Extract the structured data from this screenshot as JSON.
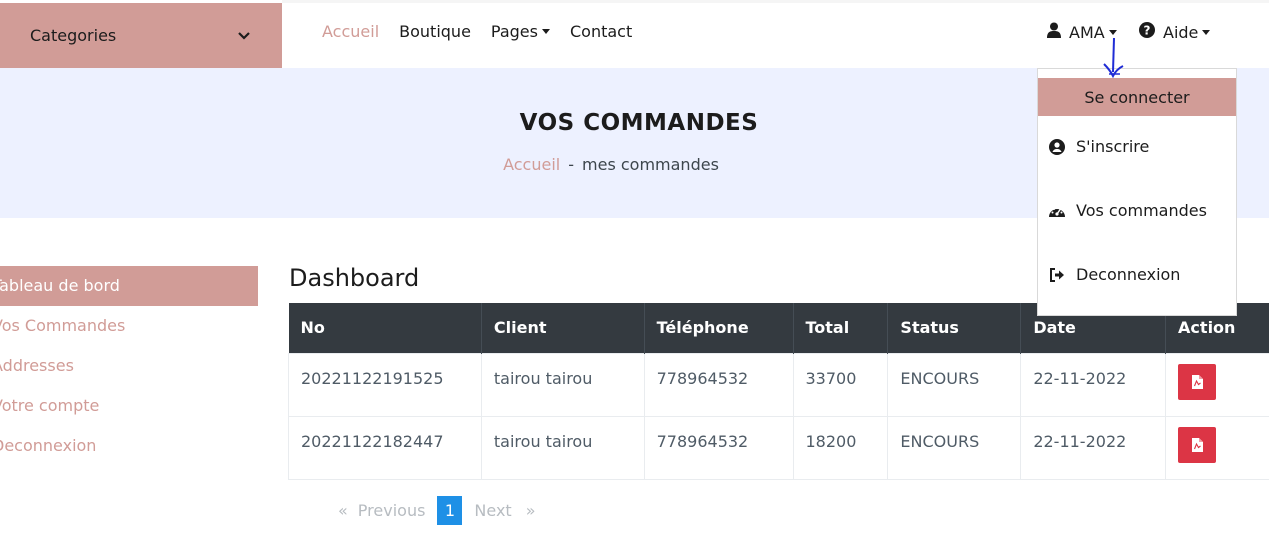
{
  "nav": {
    "categories_label": "Categories",
    "items": [
      {
        "label": "Accueil",
        "active": true
      },
      {
        "label": "Boutique"
      },
      {
        "label": "Pages",
        "dropdown": true
      },
      {
        "label": "Contact"
      }
    ],
    "user_label": "AMA",
    "help_label": "Aide"
  },
  "header": {
    "title": "VOS COMMANDES",
    "breadcrumb_home": "Accueil",
    "breadcrumb_sep": "-",
    "breadcrumb_current": "mes commandes"
  },
  "sidebar": {
    "items": [
      {
        "label": "Tableau de bord",
        "active": true
      },
      {
        "label": "Vos Commandes"
      },
      {
        "label": "Addresses"
      },
      {
        "label": "Votre compte"
      },
      {
        "label": "Deconnexion"
      }
    ]
  },
  "dashboard": {
    "title": "Dashboard",
    "columns": [
      "No",
      "Client",
      "Téléphone",
      "Total",
      "Status",
      "Date",
      "Action"
    ],
    "rows": [
      {
        "no": "20221122191525",
        "client": "tairou tairou",
        "phone": "778964532",
        "total": "33700",
        "status": "ENCOURS",
        "date": "22-11-2022",
        "action_icon": "pdf-icon"
      },
      {
        "no": "20221122182447",
        "client": "tairou tairou",
        "phone": "778964532",
        "total": "18200",
        "status": "ENCOURS",
        "date": "22-11-2022",
        "action_icon": "pdf-icon"
      }
    ]
  },
  "pagination": {
    "first": "«",
    "previous": "Previous",
    "current": "1",
    "next": "Next",
    "last": "»"
  },
  "user_dropdown": {
    "header": "Se connecter",
    "items": [
      {
        "label": "S'inscrire",
        "icon": "user-circle-icon"
      },
      {
        "label": "Vos commandes",
        "icon": "dashboard-gauge-icon"
      },
      {
        "label": "Deconnexion",
        "icon": "sign-out-icon"
      }
    ]
  },
  "colors": {
    "accent": "#d19c97",
    "band": "#edf1ff",
    "table_header": "#343a40",
    "pdf_button": "#dc3545",
    "page_active": "#1e90e6"
  }
}
